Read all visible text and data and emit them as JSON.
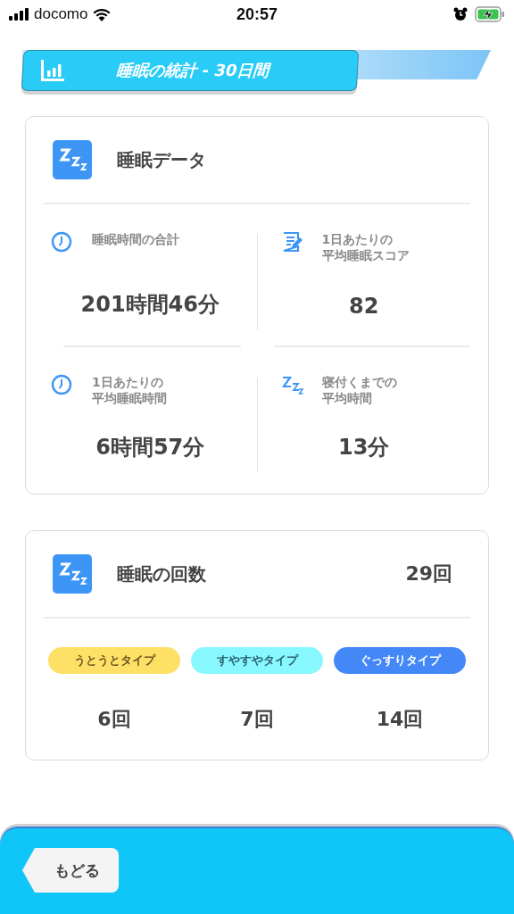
{
  "status_bar": {
    "carrier": "docomo",
    "time": "20:57"
  },
  "header": {
    "title": "睡眠の統計 - 30日間"
  },
  "sleep_data": {
    "title": "睡眠データ",
    "stats": [
      {
        "kind": "clock",
        "label_lines": [
          "睡眠時間の合計"
        ],
        "value": "201時間46分"
      },
      {
        "kind": "memo",
        "label_lines": [
          "1日あたりの",
          "平均睡眠スコア"
        ],
        "value": "82"
      },
      {
        "kind": "clock",
        "label_lines": [
          "1日あたりの",
          "平均睡眠時間"
        ],
        "value": "6時間57分"
      },
      {
        "kind": "zzz",
        "label_lines": [
          "寝付くまでの",
          "平均時間"
        ],
        "value": "13分"
      }
    ]
  },
  "sleep_count": {
    "title": "睡眠の回数",
    "total": "29回",
    "types": [
      {
        "label": "うとうとタイプ",
        "color": "#ffe066",
        "count": "6回"
      },
      {
        "label": "すやすやタイプ",
        "color": "#88f8ff",
        "count": "7回"
      },
      {
        "label": "ぐっすりタイプ",
        "color": "#4488f8",
        "count": "14回"
      }
    ]
  },
  "back_button": {
    "label": "もどる"
  }
}
